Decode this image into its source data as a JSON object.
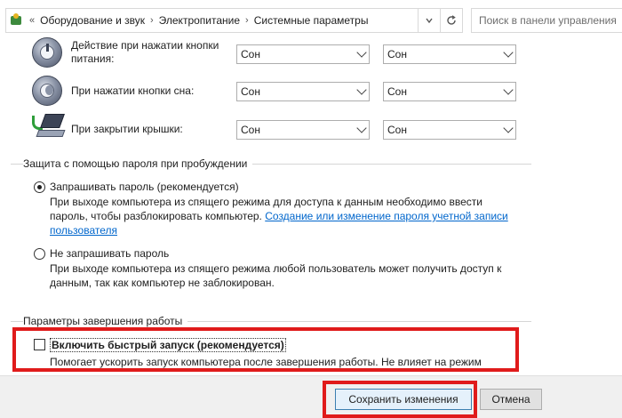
{
  "breadcrumb": {
    "back_arrows": "«",
    "items": [
      "Оборудование и звук",
      "Электропитание",
      "Системные параметры"
    ],
    "separator": "›"
  },
  "search": {
    "placeholder": "Поиск в панели управления"
  },
  "power_rows": [
    {
      "label_line1": "Действие при нажатии кнопки",
      "label_line2": "питания:",
      "icon": "power-button-icon",
      "battery_value": "Сон",
      "plugged_value": "Сон"
    },
    {
      "label_line1": "При нажатии кнопки сна:",
      "label_line2": "",
      "icon": "sleep-button-icon",
      "battery_value": "Сон",
      "plugged_value": "Сон"
    },
    {
      "label_line1": "При закрытии крышки:",
      "label_line2": "",
      "icon": "laptop-lid-icon",
      "battery_value": "Сон",
      "plugged_value": "Сон"
    }
  ],
  "password_section": {
    "title": "Защита с помощью пароля при пробуждении",
    "require": {
      "label": "Запрашивать пароль (рекомендуется)",
      "desc_line1": "При выходе компьютера из спящего режима для доступа к данным необходимо ввести",
      "desc_line2_prefix": "пароль, чтобы разблокировать компьютер. ",
      "link_part1": "Создание или изменение пароля учетной записи",
      "link_part2": "пользователя",
      "checked": true
    },
    "no_require": {
      "label": "Не запрашивать пароль",
      "desc_line1": "При выходе компьютера из спящего режима любой пользователь может получить доступ к",
      "desc_line2": "данным, так как компьютер не заблокирован.",
      "checked": false
    }
  },
  "shutdown_section": {
    "title": "Параметры завершения работы",
    "fast_startup": {
      "label": "Включить быстрый запуск (рекомендуется)",
      "desc": "Помогает ускорить запуск компьютера после завершения работы. Не влияет на режим",
      "checked": false
    }
  },
  "buttons": {
    "save": "Сохранить изменения",
    "cancel": "Отмена"
  },
  "colors": {
    "highlight": "#e01b1b",
    "link": "#0066cc"
  }
}
